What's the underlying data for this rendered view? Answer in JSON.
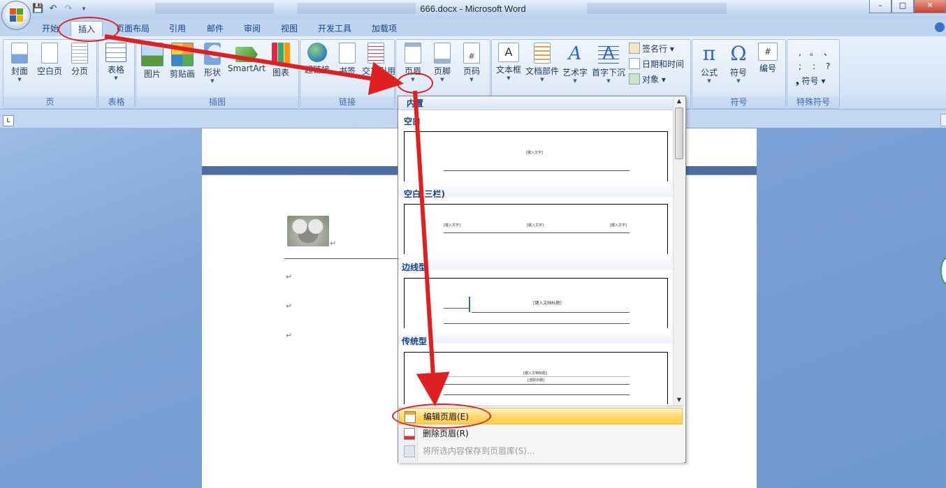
{
  "window": {
    "title": "666.docx - Microsoft Word",
    "controls": [
      "–",
      "□",
      "✕"
    ]
  },
  "tabs": [
    {
      "label": "开始"
    },
    {
      "label": "插入",
      "active": true
    },
    {
      "label": "页面布局"
    },
    {
      "label": "引用"
    },
    {
      "label": "邮件"
    },
    {
      "label": "审阅"
    },
    {
      "label": "视图"
    },
    {
      "label": "开发工具"
    },
    {
      "label": "加载项"
    }
  ],
  "ribbon": {
    "groups": {
      "page": {
        "label": "页",
        "buttons": [
          "封面",
          "空白页",
          "分页"
        ]
      },
      "table": {
        "label": "表格",
        "buttons": [
          "表格"
        ]
      },
      "illustrations": {
        "label": "插图",
        "buttons": [
          "图片",
          "剪贴画",
          "形状",
          "SmartArt",
          "图表"
        ]
      },
      "links": {
        "label": "链接",
        "buttons": [
          "超链接",
          "书签",
          "交叉引用"
        ]
      },
      "header_footer": {
        "buttons": [
          "页眉",
          "页脚",
          "页码"
        ]
      },
      "text": {
        "buttons": [
          "文本框",
          "文档部件",
          "艺术字",
          "首字下沉"
        ],
        "small": [
          "签名行",
          "日期和时间",
          "对象"
        ]
      },
      "symbols": {
        "label": "符号",
        "buttons": [
          "公式",
          "符号",
          "编号"
        ]
      },
      "special": {
        "label": "特殊符号",
        "glyphs": [
          ",",
          "。",
          "、",
          ";",
          ":",
          "?"
        ],
        "button": "符号"
      }
    }
  },
  "gallery": {
    "header": "内置",
    "sections": [
      {
        "title": "空白",
        "texts": [
          "[键入文字]"
        ]
      },
      {
        "title": "空白(三栏)",
        "texts": [
          "[键入文字]",
          "[键入文字]",
          "[键入文字]"
        ]
      },
      {
        "title": "边线型",
        "texts": [
          "[键入文档标题]"
        ]
      },
      {
        "title": "传统型",
        "texts": [
          "[键入文档标题]",
          "[选取日期]"
        ]
      }
    ],
    "menu": [
      {
        "label": "编辑页眉(E)",
        "highlighted": true
      },
      {
        "label": "删除页眉(R)"
      },
      {
        "label": "将所选内容保存到页眉库(S)...",
        "disabled": true
      }
    ]
  },
  "document": {
    "paragraph_mark": "↵"
  },
  "colors": {
    "annotation_red": "#e02020",
    "ribbon_bg": "#dfeaf8",
    "highlight": "#ffd666"
  }
}
